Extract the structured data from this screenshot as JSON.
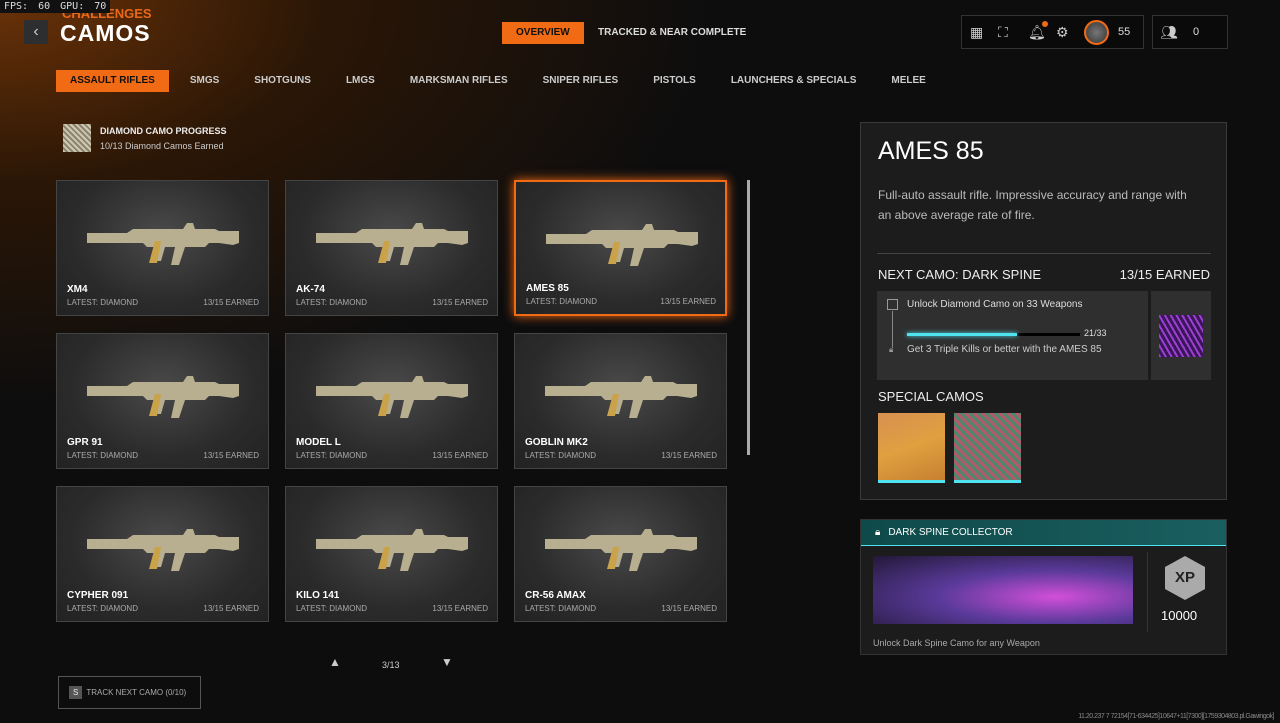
{
  "overlay": {
    "fps_label": "FPS:",
    "fps": "60",
    "gpu_label": "GPU:",
    "gpu": "70"
  },
  "header": {
    "breadcrumb": "CHALLENGES",
    "title": "CAMOS",
    "tabs": [
      {
        "label": "OVERVIEW"
      },
      {
        "label": "TRACKED & NEAR COMPLETE"
      }
    ],
    "level": "55",
    "party_count": "0"
  },
  "categories": [
    "ASSAULT RIFLES",
    "SMGS",
    "SHOTGUNS",
    "LMGS",
    "MARKSMAN RIFLES",
    "SNIPER RIFLES",
    "PISTOLS",
    "LAUNCHERS & SPECIALS",
    "MELEE"
  ],
  "diamond": {
    "title": "DIAMOND CAMO PROGRESS",
    "subtitle": "10/13 Diamond Camos Earned"
  },
  "weapons": [
    {
      "name": "XM4",
      "latest": "LATEST: DIAMOND",
      "earned": "13/15 EARNED"
    },
    {
      "name": "AK-74",
      "latest": "LATEST: DIAMOND",
      "earned": "13/15 EARNED"
    },
    {
      "name": "AMES 85",
      "latest": "LATEST: DIAMOND",
      "earned": "13/15 EARNED"
    },
    {
      "name": "GPR 91",
      "latest": "LATEST: DIAMOND",
      "earned": "13/15 EARNED"
    },
    {
      "name": "MODEL L",
      "latest": "LATEST: DIAMOND",
      "earned": "13/15 EARNED"
    },
    {
      "name": "GOBLIN MK2",
      "latest": "LATEST: DIAMOND",
      "earned": "13/15 EARNED"
    },
    {
      "name": "CYPHER 091",
      "latest": "LATEST: DIAMOND",
      "earned": "13/15 EARNED"
    },
    {
      "name": "KILO 141",
      "latest": "LATEST: DIAMOND",
      "earned": "13/15 EARNED"
    },
    {
      "name": "CR-56 AMAX",
      "latest": "LATEST: DIAMOND",
      "earned": "13/15 EARNED"
    }
  ],
  "pagination": {
    "page": "3/13"
  },
  "track": {
    "key": "S",
    "label": "TRACK NEXT CAMO (0/10)"
  },
  "detail": {
    "name": "AMES 85",
    "description": "Full-auto assault rifle.  Impressive accuracy and range with an above average rate of fire.",
    "next_camo": "NEXT CAMO: DARK SPINE",
    "earned": "13/15 EARNED",
    "challenge": "Unlock Diamond Camo on 33 Weapons",
    "progress_text": "21/33",
    "progress": 0.636,
    "next_challenge": "Get 3 Triple Kills or better with the AMES 85",
    "special_title": "SPECIAL CAMOS"
  },
  "collector": {
    "title": "DARK SPINE COLLECTOR",
    "xp": "10000",
    "description": "Unlock Dark Spine Camo for any Weapon"
  },
  "footer_id": "11.20.237 7 72154[71-634425]10647+11[7300][1759304803.pl.Gawingok]"
}
